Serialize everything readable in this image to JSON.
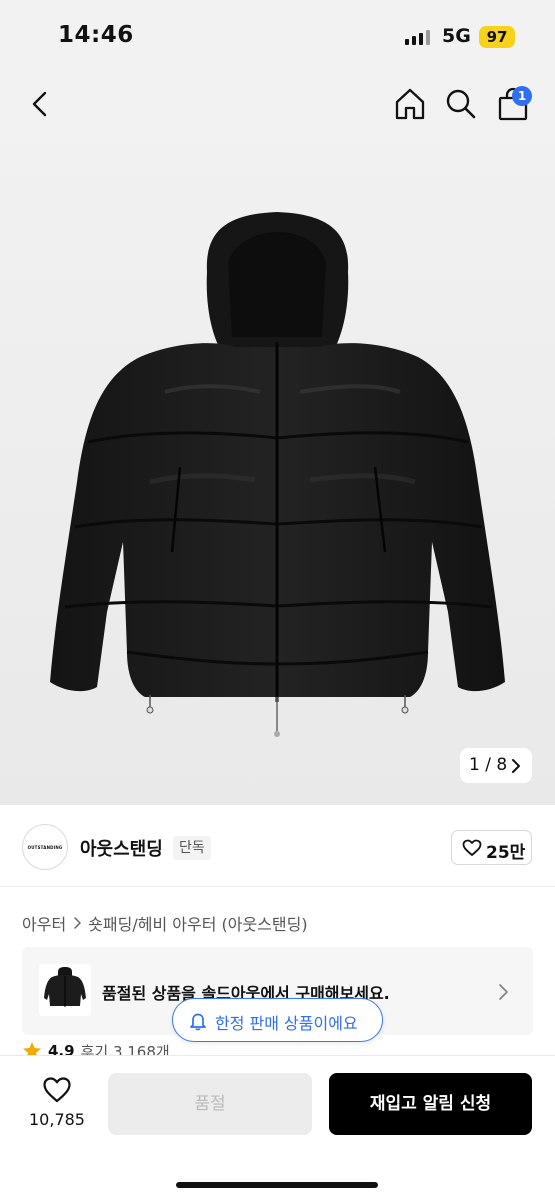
{
  "status_bar": {
    "time": "14:46",
    "network": "5G",
    "battery": "97"
  },
  "nav": {
    "cart_count": "1",
    "icons": [
      "back-arrow-icon",
      "home-icon",
      "search-icon",
      "shopping-bag-icon"
    ]
  },
  "image": {
    "counter": "1 / 8"
  },
  "brand": {
    "logo_text": "OUTSTANDING",
    "name": "아웃스탠딩",
    "tag": "단독",
    "likes": "25만"
  },
  "breadcrumb": {
    "category": "아우터",
    "subcategory": "숏패딩/헤비 아우터 (아웃스탠딩)"
  },
  "soldout_banner": {
    "text": "품절된 상품을 솔드아웃에서 구매해보세요."
  },
  "limited_pill": {
    "text": "한정 판매 상품이에요"
  },
  "rating": {
    "score": "4.9",
    "reviews": "후기 3,168개"
  },
  "bottom": {
    "wish_count": "10,785",
    "soldout_label": "품절",
    "restock_label": "재입고 알림 신청"
  },
  "colors": {
    "accent_blue": "#2f6ff0",
    "battery_yellow": "#f7d21a",
    "primary_black": "#000000"
  }
}
